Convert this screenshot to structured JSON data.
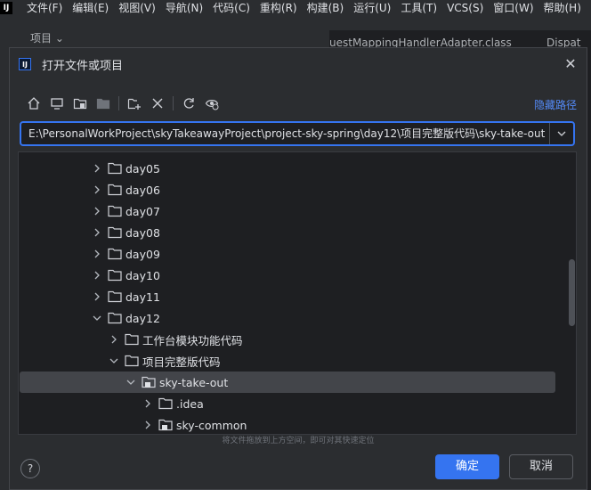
{
  "menu": {
    "logo": "IJ",
    "items": [
      "文件(F)",
      "编辑(E)",
      "视图(V)",
      "导航(N)",
      "代码(C)",
      "重构(R)",
      "构建(B)",
      "运行(U)",
      "工具(T)",
      "VCS(S)",
      "窗口(W)",
      "帮助(H)"
    ]
  },
  "background": {
    "project_label": "项目 ⌄",
    "tab1": "uestMappingHandlerAdapter.class",
    "tab2": "Dispat"
  },
  "dialog": {
    "icon_text": "IJ",
    "title": "打开文件或项目",
    "hide_path": "隐藏路径",
    "path_value": "E:\\PersonalWorkProject\\skyTakeawayProject\\project-sky-spring\\day12\\项目完整版代码\\sky-take-out",
    "toolbar_icons": [
      "home-icon",
      "desktop-icon",
      "project-folder-icon",
      "module-folder-icon",
      "new-folder-icon",
      "delete-icon",
      "refresh-icon",
      "show-hidden-icon"
    ],
    "tree": [
      {
        "label": "day05",
        "expanded": false
      },
      {
        "label": "day06",
        "expanded": false
      },
      {
        "label": "day07",
        "expanded": false
      },
      {
        "label": "day08",
        "expanded": false
      },
      {
        "label": "day09",
        "expanded": false
      },
      {
        "label": "day10",
        "expanded": false
      },
      {
        "label": "day11",
        "expanded": false
      },
      {
        "label": "day12",
        "expanded": true
      },
      {
        "label": "工作台模块功能代码",
        "expanded": false
      },
      {
        "label": "项目完整版代码",
        "expanded": true
      },
      {
        "label": "sky-take-out",
        "expanded": true,
        "selected": true
      },
      {
        "label": ".idea",
        "expanded": false
      },
      {
        "label": "sky-common",
        "expanded": false
      }
    ],
    "drop_hint": "将文件拖放到上方空间，即可对其快速定位",
    "help": "?",
    "ok": "确定",
    "cancel": "取消"
  },
  "colors": {
    "accent": "#3574f0",
    "link": "#548af7",
    "dialog_bg": "#2b2d30",
    "tree_bg": "#1e1f22",
    "selection": "#43454a"
  }
}
